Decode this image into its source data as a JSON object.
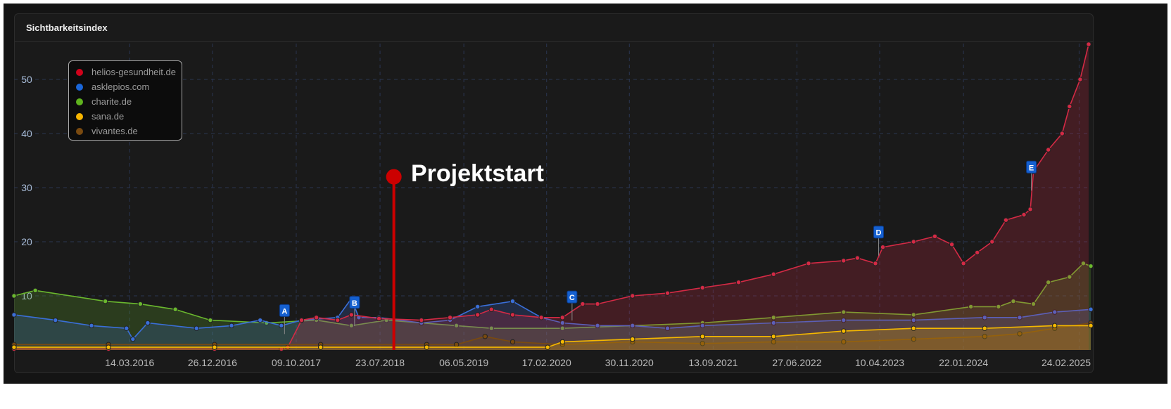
{
  "card": {
    "title": "Sichtbarkeitsindex"
  },
  "chart_data": {
    "type": "line",
    "title": "Sichtbarkeitsindex",
    "xlabel": "",
    "ylabel": "",
    "x_unit": "decimal year",
    "xlim": [
      2015.11,
      2025.26
    ],
    "ylim": [
      0,
      57
    ],
    "yticks": [
      10,
      20,
      30,
      40,
      50
    ],
    "xticks": [
      {
        "x": 2016.2,
        "label": "14.03.2016"
      },
      {
        "x": 2016.98,
        "label": "26.12.2016"
      },
      {
        "x": 2017.77,
        "label": "09.10.2017"
      },
      {
        "x": 2018.56,
        "label": "23.07.2018"
      },
      {
        "x": 2019.35,
        "label": "06.05.2019"
      },
      {
        "x": 2020.13,
        "label": "17.02.2020"
      },
      {
        "x": 2020.91,
        "label": "30.11.2020"
      },
      {
        "x": 2021.7,
        "label": "13.09.2021"
      },
      {
        "x": 2022.49,
        "label": "27.06.2022"
      },
      {
        "x": 2023.27,
        "label": "10.04.2023"
      },
      {
        "x": 2024.06,
        "label": "22.01.2024"
      },
      {
        "x": 2025.15,
        "label": "24.02.2025"
      }
    ],
    "grid": true,
    "legend_position": "top-left",
    "series": [
      {
        "name": "helios-gesundheit.de",
        "color": "#d42a45",
        "points": [
          [
            2015.11,
            0.2
          ],
          [
            2016.0,
            0.2
          ],
          [
            2017.0,
            0.2
          ],
          [
            2017.63,
            0.2
          ],
          [
            2017.69,
            0.5
          ],
          [
            2017.82,
            5.5
          ],
          [
            2017.96,
            6.0
          ],
          [
            2018.16,
            5.5
          ],
          [
            2018.29,
            6.5
          ],
          [
            2018.55,
            5.8
          ],
          [
            2018.95,
            5.5
          ],
          [
            2019.22,
            6.0
          ],
          [
            2019.48,
            6.5
          ],
          [
            2019.61,
            7.5
          ],
          [
            2019.81,
            6.5
          ],
          [
            2020.08,
            6.0
          ],
          [
            2020.28,
            6.0
          ],
          [
            2020.47,
            8.5
          ],
          [
            2020.61,
            8.5
          ],
          [
            2020.94,
            10.0
          ],
          [
            2021.27,
            10.5
          ],
          [
            2021.6,
            11.5
          ],
          [
            2021.94,
            12.5
          ],
          [
            2022.27,
            14.0
          ],
          [
            2022.6,
            16.0
          ],
          [
            2022.93,
            16.5
          ],
          [
            2023.06,
            17.0
          ],
          [
            2023.23,
            16.0
          ],
          [
            2023.3,
            19.0
          ],
          [
            2023.59,
            20.0
          ],
          [
            2023.79,
            21.0
          ],
          [
            2023.95,
            19.5
          ],
          [
            2024.06,
            16.0
          ],
          [
            2024.19,
            18.0
          ],
          [
            2024.33,
            20.0
          ],
          [
            2024.46,
            24.0
          ],
          [
            2024.63,
            25.0
          ],
          [
            2024.69,
            26.0
          ],
          [
            2024.72,
            33.0
          ],
          [
            2024.86,
            37.0
          ],
          [
            2024.99,
            40.0
          ],
          [
            2025.06,
            45.0
          ],
          [
            2025.16,
            50.0
          ],
          [
            2025.24,
            56.5
          ]
        ]
      },
      {
        "name": "asklepios.com",
        "color": "#3a6fd8",
        "points": [
          [
            2015.11,
            6.5
          ],
          [
            2015.5,
            5.5
          ],
          [
            2015.84,
            4.5
          ],
          [
            2016.17,
            4.0
          ],
          [
            2016.23,
            2.0
          ],
          [
            2016.37,
            5.0
          ],
          [
            2016.83,
            4.0
          ],
          [
            2017.16,
            4.5
          ],
          [
            2017.43,
            5.5
          ],
          [
            2017.63,
            4.5
          ],
          [
            2017.82,
            5.5
          ],
          [
            2018.16,
            6.0
          ],
          [
            2018.29,
            9.5
          ],
          [
            2018.36,
            6.0
          ],
          [
            2018.55,
            6.0
          ],
          [
            2018.95,
            5.0
          ],
          [
            2019.22,
            5.5
          ],
          [
            2019.48,
            8.0
          ],
          [
            2019.81,
            9.0
          ],
          [
            2020.08,
            6.0
          ],
          [
            2020.28,
            5.0
          ],
          [
            2020.61,
            4.5
          ],
          [
            2020.94,
            4.5
          ],
          [
            2021.27,
            4.0
          ],
          [
            2021.6,
            4.5
          ],
          [
            2022.27,
            5.0
          ],
          [
            2022.93,
            5.5
          ],
          [
            2023.59,
            5.5
          ],
          [
            2024.26,
            6.0
          ],
          [
            2024.59,
            6.0
          ],
          [
            2024.92,
            7.0
          ],
          [
            2025.26,
            7.5
          ]
        ]
      },
      {
        "name": "charite.de",
        "color": "#6ab82e",
        "points": [
          [
            2015.11,
            10.0
          ],
          [
            2015.31,
            11.0
          ],
          [
            2015.97,
            9.0
          ],
          [
            2016.3,
            8.5
          ],
          [
            2016.63,
            7.5
          ],
          [
            2016.96,
            5.5
          ],
          [
            2017.49,
            5.0
          ],
          [
            2017.96,
            5.5
          ],
          [
            2018.29,
            4.5
          ],
          [
            2018.62,
            5.5
          ],
          [
            2018.95,
            5.0
          ],
          [
            2019.28,
            4.5
          ],
          [
            2019.61,
            4.0
          ],
          [
            2020.28,
            4.0
          ],
          [
            2020.94,
            4.5
          ],
          [
            2021.6,
            5.0
          ],
          [
            2022.27,
            6.0
          ],
          [
            2022.93,
            7.0
          ],
          [
            2023.59,
            6.5
          ],
          [
            2024.13,
            8.0
          ],
          [
            2024.39,
            8.0
          ],
          [
            2024.53,
            9.0
          ],
          [
            2024.72,
            8.5
          ],
          [
            2024.86,
            12.5
          ],
          [
            2025.06,
            13.5
          ],
          [
            2025.19,
            16.0
          ],
          [
            2025.26,
            15.5
          ]
        ]
      },
      {
        "name": "sana.de",
        "color": "#f5b800",
        "points": [
          [
            2015.11,
            0.5
          ],
          [
            2016.0,
            0.5
          ],
          [
            2017.0,
            0.5
          ],
          [
            2018.0,
            0.5
          ],
          [
            2019.0,
            0.5
          ],
          [
            2020.14,
            0.5
          ],
          [
            2020.28,
            1.5
          ],
          [
            2020.94,
            2.0
          ],
          [
            2021.6,
            2.5
          ],
          [
            2022.27,
            2.5
          ],
          [
            2022.93,
            3.5
          ],
          [
            2023.59,
            4.0
          ],
          [
            2024.26,
            4.0
          ],
          [
            2024.92,
            4.5
          ],
          [
            2025.26,
            4.5
          ]
        ]
      },
      {
        "name": "vivantes.de",
        "color": "#7a4a10",
        "points": [
          [
            2015.11,
            1.0
          ],
          [
            2016.0,
            1.0
          ],
          [
            2017.0,
            1.0
          ],
          [
            2018.0,
            1.0
          ],
          [
            2019.0,
            1.0
          ],
          [
            2019.28,
            1.0
          ],
          [
            2019.55,
            2.5
          ],
          [
            2019.81,
            1.5
          ],
          [
            2020.28,
            1.0
          ],
          [
            2020.94,
            1.5
          ],
          [
            2021.6,
            1.2
          ],
          [
            2022.27,
            1.5
          ],
          [
            2022.93,
            1.5
          ],
          [
            2023.59,
            2.0
          ],
          [
            2024.26,
            2.5
          ],
          [
            2024.59,
            3.0
          ],
          [
            2024.92,
            4.0
          ],
          [
            2025.26,
            5.0
          ]
        ]
      }
    ],
    "annotations": [
      {
        "label": "A",
        "x": 2017.66,
        "y": 4.5
      },
      {
        "label": "B",
        "x": 2018.32,
        "y": 6.0
      },
      {
        "label": "C",
        "x": 2020.37,
        "y": 7.0
      },
      {
        "label": "D",
        "x": 2023.26,
        "y": 19.0
      },
      {
        "label": "E",
        "x": 2024.7,
        "y": 31.0
      }
    ],
    "marker": {
      "label": "Projektstart",
      "x": 2018.69,
      "y": 32,
      "color": "#cc0000"
    }
  }
}
